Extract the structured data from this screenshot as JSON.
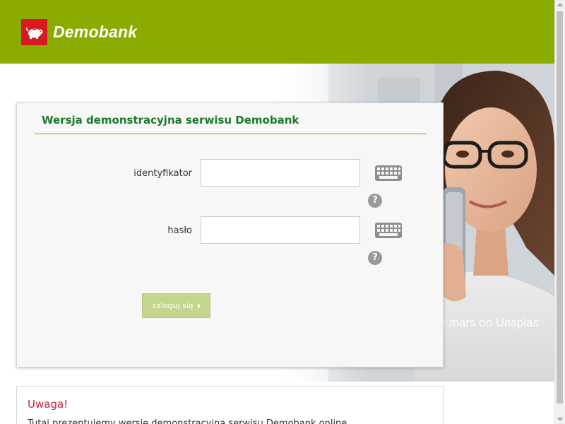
{
  "header": {
    "brand": "Demobank",
    "logo_icon": "piggy-bank-icon",
    "background": "#8aab00",
    "logo_color": "#d8191f"
  },
  "login": {
    "title": "Wersja demonstracyjna serwisu Demobank",
    "fields": [
      {
        "label": "identyfikator",
        "value": "",
        "keyboard_icon": "keyboard-icon",
        "help_icon": "help-icon",
        "help_glyph": "?"
      },
      {
        "label": "hasło",
        "value": "",
        "keyboard_icon": "keyboard-icon",
        "help_icon": "help-icon",
        "help_glyph": "?"
      }
    ],
    "submit_label": "zaloguj się",
    "submit_color": "#c4d58e"
  },
  "hero": {
    "photo_credit": "ce mars on Unsplas"
  },
  "warning": {
    "title": "Uwaga!",
    "text": "Tutaj prezentujemy wersję demonstracyjną serwisu Demobank online.",
    "title_color": "#cc1f3a"
  }
}
